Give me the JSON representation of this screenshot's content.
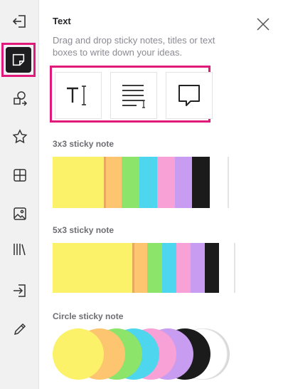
{
  "sidebar": {
    "items": [
      {
        "name": "collapse-icon"
      },
      {
        "name": "sticky-note-icon",
        "active": true
      },
      {
        "name": "shapes-icon"
      },
      {
        "name": "star-icon"
      },
      {
        "name": "grid-icon"
      },
      {
        "name": "image-icon"
      },
      {
        "name": "library-icon"
      },
      {
        "name": "import-icon"
      },
      {
        "name": "pencil-icon"
      }
    ]
  },
  "panel": {
    "title": "Text",
    "description": "Drag and drop sticky notes, titles or text boxes to write down your ideas.",
    "text_tools": [
      "title-text-tool",
      "paragraph-text-tool",
      "comment-bubble-tool"
    ],
    "sections": [
      {
        "label": "3x3 sticky note"
      },
      {
        "label": "5x3 sticky note"
      },
      {
        "label": "Circle sticky note"
      }
    ]
  },
  "colors": {
    "accent": "#e1197a",
    "sticky": [
      "#fcf26a",
      "#fdc56f",
      "#8de46a",
      "#4ed6ef",
      "#f8a1d6",
      "#c89df1",
      "#1b1b1b",
      "#ffffff"
    ]
  }
}
